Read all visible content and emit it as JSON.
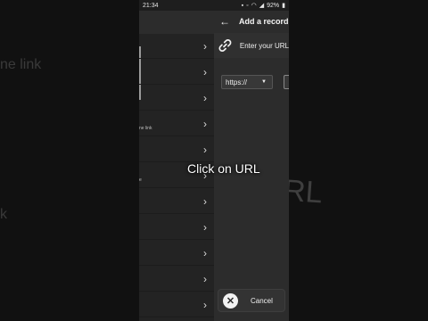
{
  "background": {
    "left_text_1": "ne link",
    "left_text_2": "k",
    "right_text": "RL"
  },
  "status_bar": {
    "time": "21:34",
    "icons": [
      "notification-icon",
      "mute-icon",
      "wifi-icon",
      "signal-icon"
    ],
    "battery": "92%"
  },
  "list": {
    "row_texts": [
      "",
      "",
      "",
      "ne link",
      "",
      "e",
      "",
      "",
      "",
      "",
      ""
    ]
  },
  "dialog": {
    "back_icon": "back-arrow-icon",
    "title": "Add a record",
    "url_row": {
      "icon": "link-icon",
      "label": "Enter your URL"
    },
    "scheme": {
      "value": "https://"
    },
    "cancel": {
      "icon": "close-circle-icon",
      "label": "Cancel"
    }
  },
  "overlay_caption": "Click on URL",
  "colors": {
    "background": "#111111",
    "panel": "#2c2c2c",
    "text": "#f0f0f0"
  }
}
